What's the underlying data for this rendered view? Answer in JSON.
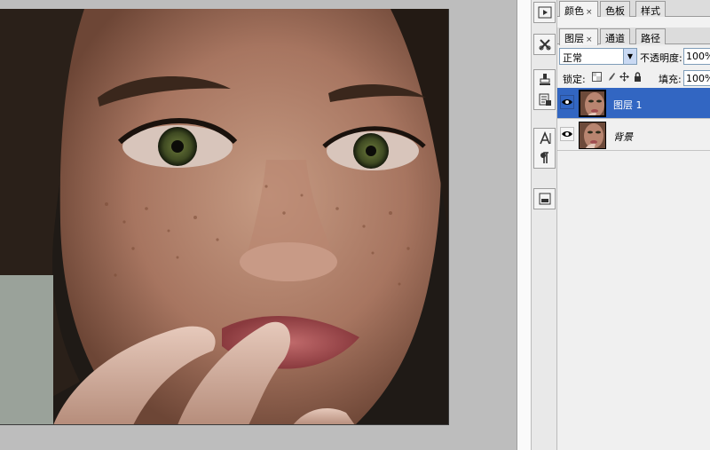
{
  "panels": {
    "top_tabs": [
      {
        "label": "颜色",
        "active": true,
        "closable": true
      },
      {
        "label": "色板",
        "active": false,
        "closable": false
      },
      {
        "label": "样式",
        "active": false,
        "closable": false
      }
    ],
    "layer_tabs": [
      {
        "label": "图层",
        "active": true,
        "closable": true
      },
      {
        "label": "通道",
        "active": false,
        "closable": false
      },
      {
        "label": "路径",
        "active": false,
        "closable": false
      }
    ],
    "close_glyph": "×"
  },
  "layers_panel": {
    "blend_mode": "正常",
    "opacity_label": "不透明度:",
    "opacity_value": "100%",
    "lock_label": "锁定:",
    "fill_label": "填充:",
    "fill_value": "100%",
    "layers": [
      {
        "name": "图层 1",
        "selected": true,
        "visible": true
      },
      {
        "name": "背景",
        "selected": false,
        "visible": true
      }
    ]
  },
  "toolbar": {
    "icons": [
      "play-icon",
      "tools-icon",
      "brush-stamp-icon",
      "history-icon",
      "character-icon",
      "paragraph-icon",
      "navigator-icon"
    ]
  },
  "colors": {
    "selected_layer": "#3266c2",
    "workspace_bg": "#bdbdbd"
  }
}
